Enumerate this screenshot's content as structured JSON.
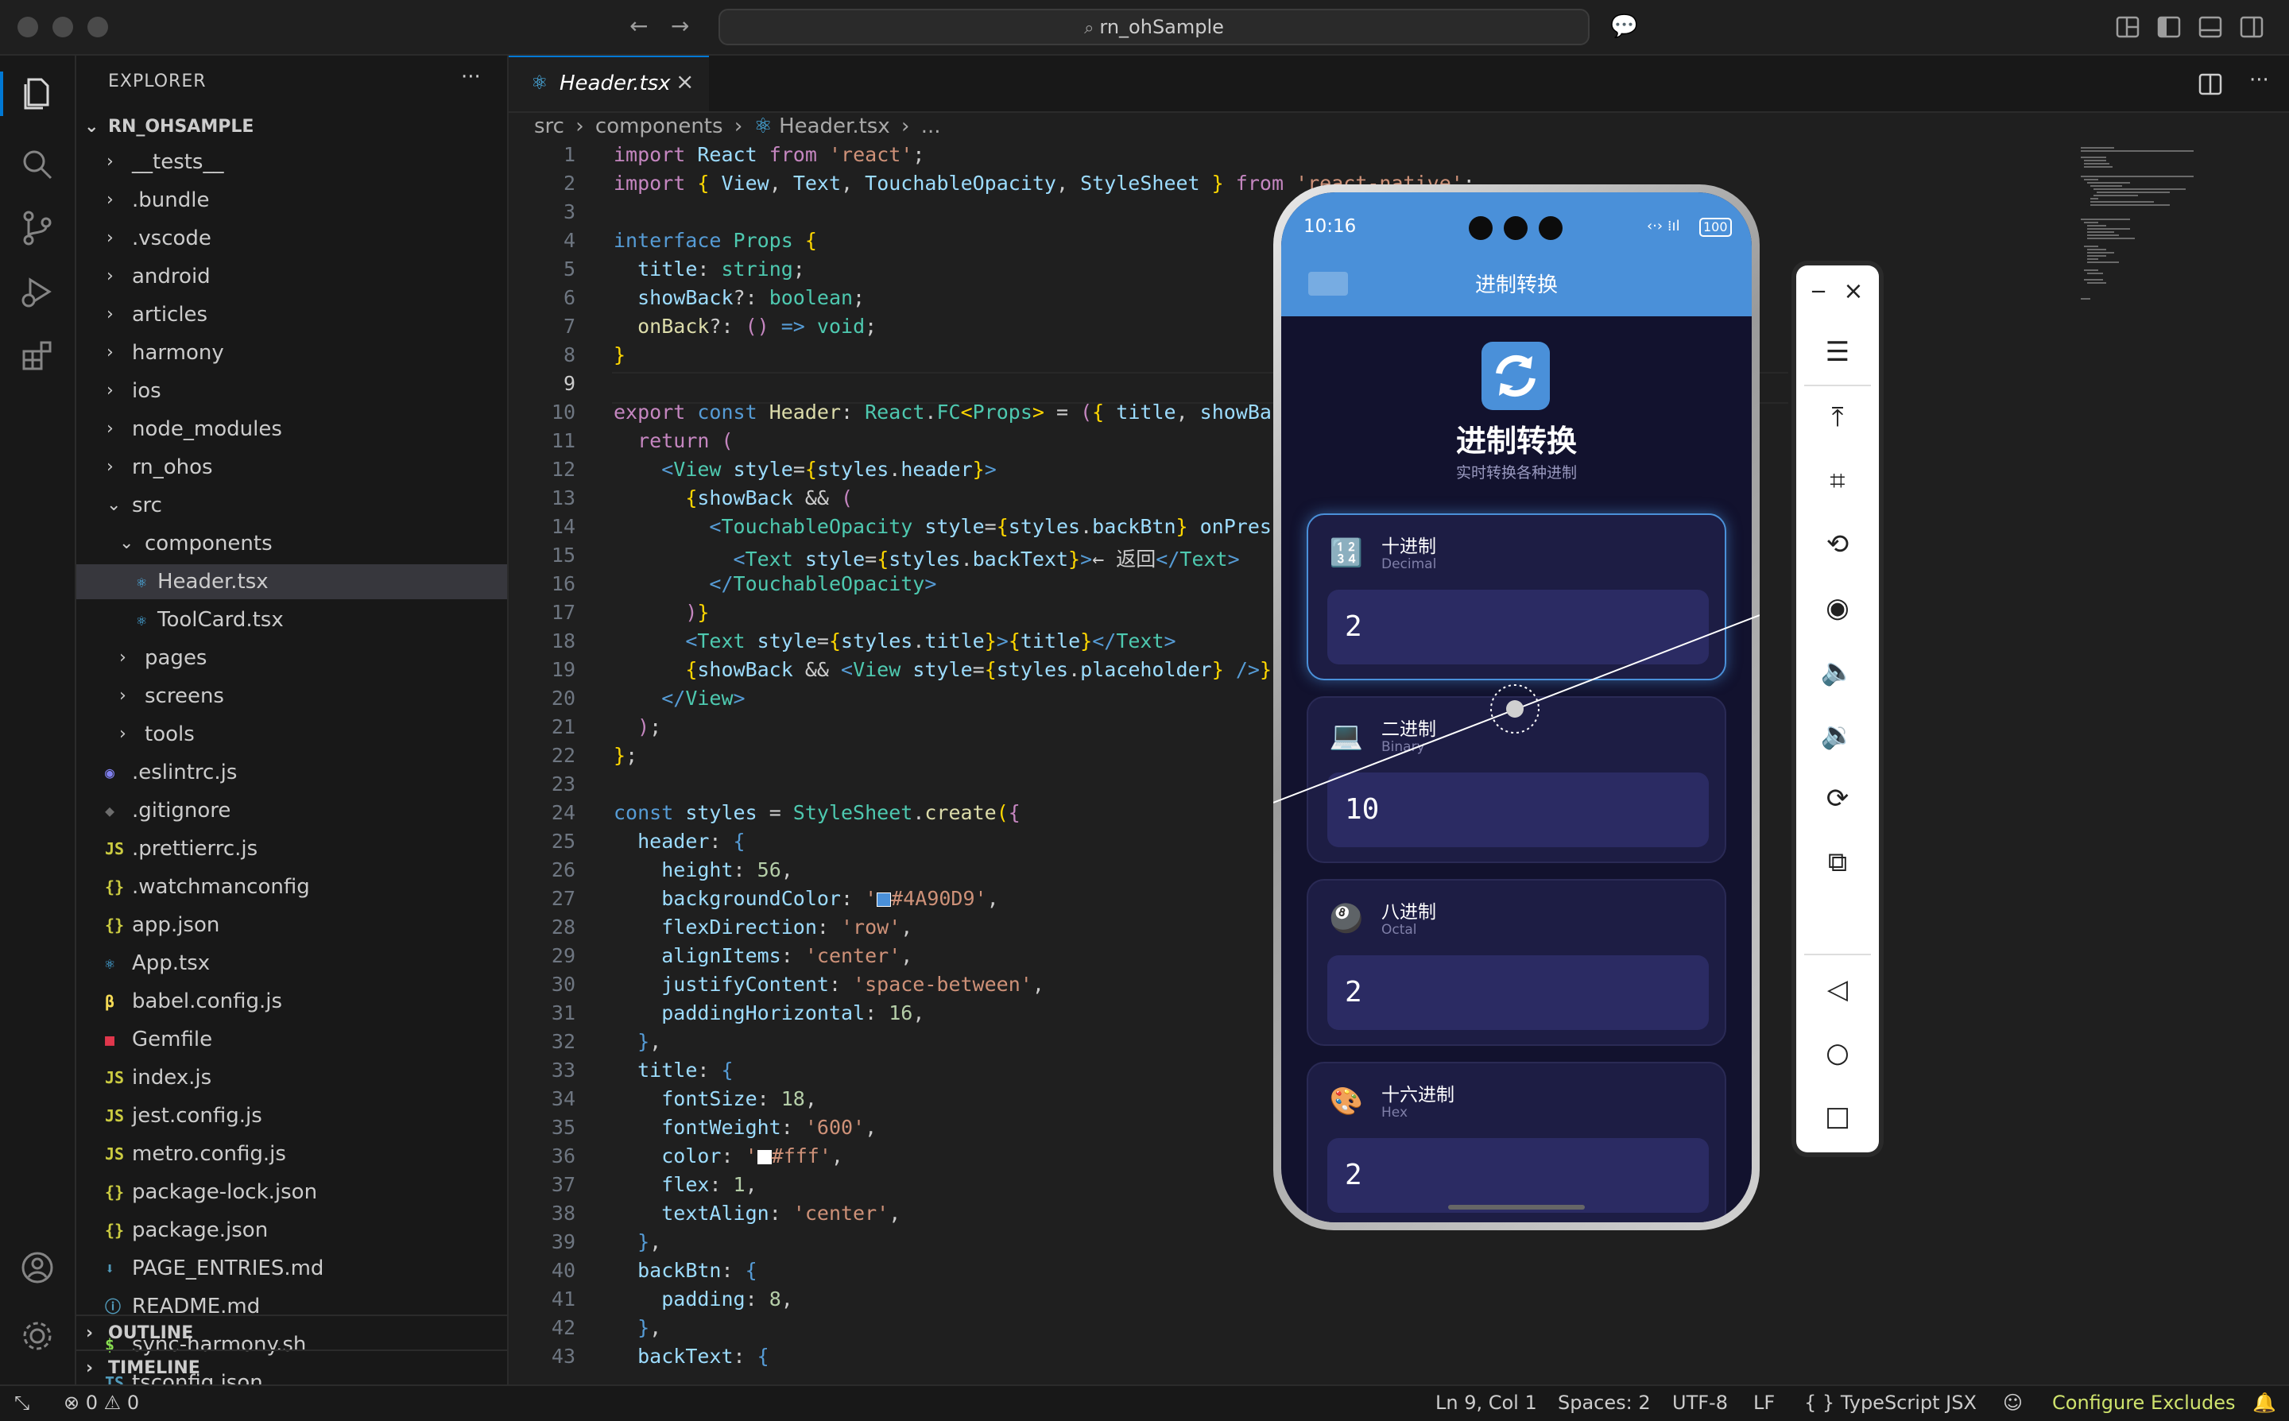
{
  "window": {
    "search_text": "rn_ohSample"
  },
  "sidebar": {
    "title": "EXPLORER",
    "root": "RN_OHSAMPLE",
    "items": [
      {
        "label": "__tests__",
        "kind": "folder",
        "depth": 1,
        "open": false
      },
      {
        "label": ".bundle",
        "kind": "folder",
        "depth": 1,
        "open": false
      },
      {
        "label": ".vscode",
        "kind": "folder",
        "depth": 1,
        "open": false
      },
      {
        "label": "android",
        "kind": "folder",
        "depth": 1,
        "open": false
      },
      {
        "label": "articles",
        "kind": "folder",
        "depth": 1,
        "open": false
      },
      {
        "label": "harmony",
        "kind": "folder",
        "depth": 1,
        "open": false
      },
      {
        "label": "ios",
        "kind": "folder",
        "depth": 1,
        "open": false
      },
      {
        "label": "node_modules",
        "kind": "folder",
        "depth": 1,
        "open": false
      },
      {
        "label": "rn_ohos",
        "kind": "folder",
        "depth": 1,
        "open": false
      },
      {
        "label": "src",
        "kind": "folder",
        "depth": 1,
        "open": true
      },
      {
        "label": "components",
        "kind": "folder",
        "depth": 2,
        "open": true
      },
      {
        "label": "Header.tsx",
        "kind": "react",
        "depth": 3,
        "selected": true
      },
      {
        "label": "ToolCard.tsx",
        "kind": "react",
        "depth": 3
      },
      {
        "label": "pages",
        "kind": "folder",
        "depth": 2,
        "open": false
      },
      {
        "label": "screens",
        "kind": "folder",
        "depth": 2,
        "open": false
      },
      {
        "label": "tools",
        "kind": "folder",
        "depth": 2,
        "open": false
      },
      {
        "label": ".eslintrc.js",
        "kind": "eslint",
        "depth": 1
      },
      {
        "label": ".gitignore",
        "kind": "git",
        "depth": 1
      },
      {
        "label": ".prettierrc.js",
        "kind": "js",
        "depth": 1
      },
      {
        "label": ".watchmanconfig",
        "kind": "json",
        "depth": 1
      },
      {
        "label": "app.json",
        "kind": "json",
        "depth": 1
      },
      {
        "label": "App.tsx",
        "kind": "react",
        "depth": 1
      },
      {
        "label": "babel.config.js",
        "kind": "babel",
        "depth": 1
      },
      {
        "label": "Gemfile",
        "kind": "ruby",
        "depth": 1
      },
      {
        "label": "index.js",
        "kind": "js",
        "depth": 1
      },
      {
        "label": "jest.config.js",
        "kind": "js",
        "depth": 1
      },
      {
        "label": "metro.config.js",
        "kind": "js",
        "depth": 1
      },
      {
        "label": "package-lock.json",
        "kind": "json",
        "depth": 1
      },
      {
        "label": "package.json",
        "kind": "json",
        "depth": 1
      },
      {
        "label": "PAGE_ENTRIES.md",
        "kind": "md",
        "depth": 1
      },
      {
        "label": "README.md",
        "kind": "info",
        "depth": 1
      },
      {
        "label": "sync-harmony.sh",
        "kind": "shell",
        "depth": 1
      },
      {
        "label": "tsconfig.json",
        "kind": "ts",
        "depth": 1
      }
    ],
    "outline": "OUTLINE",
    "timeline": "TIMELINE"
  },
  "editor": {
    "tab_label": "Header.tsx",
    "breadcrumb": [
      "src",
      "components",
      "Header.tsx",
      "..."
    ],
    "current_line": 9
  },
  "phone": {
    "time": "10:16",
    "battery": "100",
    "header_title": "进制转换",
    "hero_title": "进制转换",
    "hero_subtitle": "实时转换各种进制",
    "cards": [
      {
        "title": "十进制",
        "subtitle": "Decimal",
        "value": "2",
        "icon": "decimal-icon",
        "active": true
      },
      {
        "title": "二进制",
        "subtitle": "Binary",
        "value": "10",
        "icon": "laptop-icon",
        "active": false
      },
      {
        "title": "八进制",
        "subtitle": "Octal",
        "value": "2",
        "icon": "eight-ball-icon",
        "active": false
      },
      {
        "title": "十六进制",
        "subtitle": "Hex",
        "value": "2",
        "icon": "palette-icon",
        "active": false
      }
    ]
  },
  "statusbar": {
    "errors": "0",
    "warnings": "0",
    "position": "Ln 9, Col 1",
    "spaces": "Spaces: 2",
    "encoding": "UTF-8",
    "eol": "LF",
    "language": "TypeScript JSX",
    "configure": "Configure Excludes"
  },
  "colors": {
    "accent": "#0078d4",
    "app_primary": "#4a90d9",
    "configure_text": "#cfe36d"
  }
}
